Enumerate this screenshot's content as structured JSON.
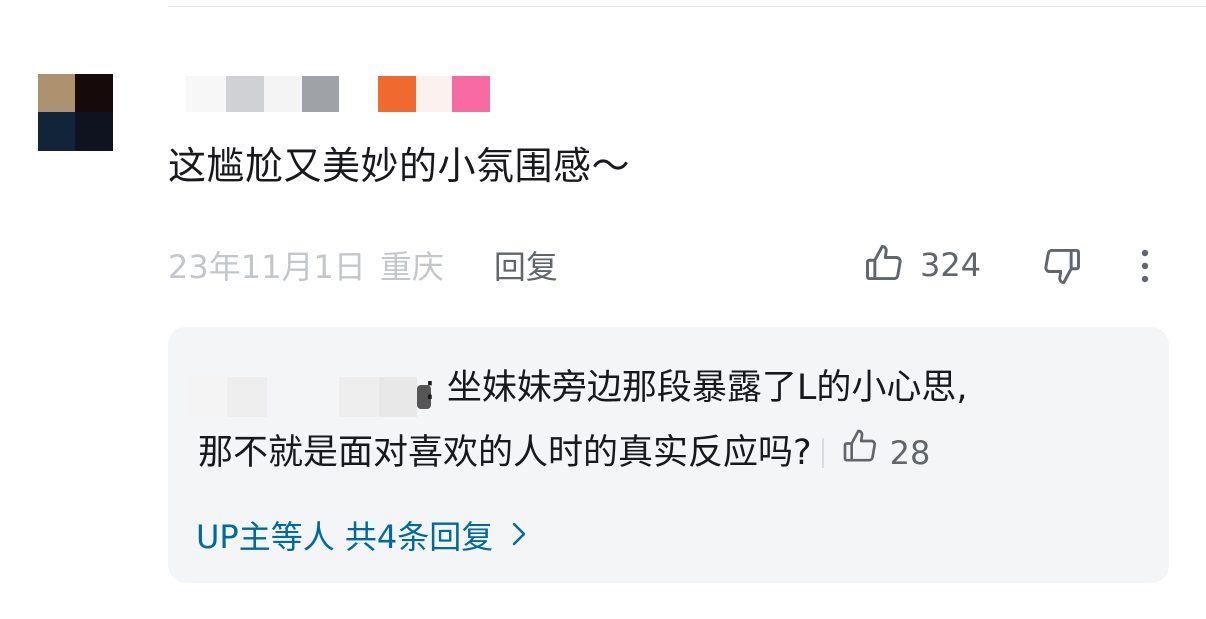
{
  "comment": {
    "avatar_pixels": [
      "#ae9270",
      "#170a0a",
      "#11243a",
      "#0f1320"
    ],
    "username_pixels": [
      "#f7f7f7",
      "#cfd1d5",
      "#f4f4f4",
      "#9fa2a7",
      "#ffffff",
      "#f06a30",
      "#fdf1ef",
      "#f86ba2"
    ],
    "text": "这尴尬又美妙的小氛围感～",
    "date": "23年11月1日",
    "location": "重庆",
    "reply_label": "回复",
    "like_count": "324",
    "icons": {
      "like": "thumbs-up-icon",
      "dislike": "thumbs-down-icon",
      "more": "more-vertical-icon"
    }
  },
  "reply_preview": {
    "username_pixels": [
      "#f4f4f4",
      "#eeeeee",
      "#ffffff",
      "#e8e8e8",
      "#555555"
    ],
    "text_line1": ": 坐妹妹旁边那段暴露了L的小心思,",
    "text_line2": "那不就是面对喜欢的人时的真实反应吗?",
    "like_count": "28",
    "view_all": "UP主等人 共4条回复",
    "link_color": "#00699d"
  }
}
